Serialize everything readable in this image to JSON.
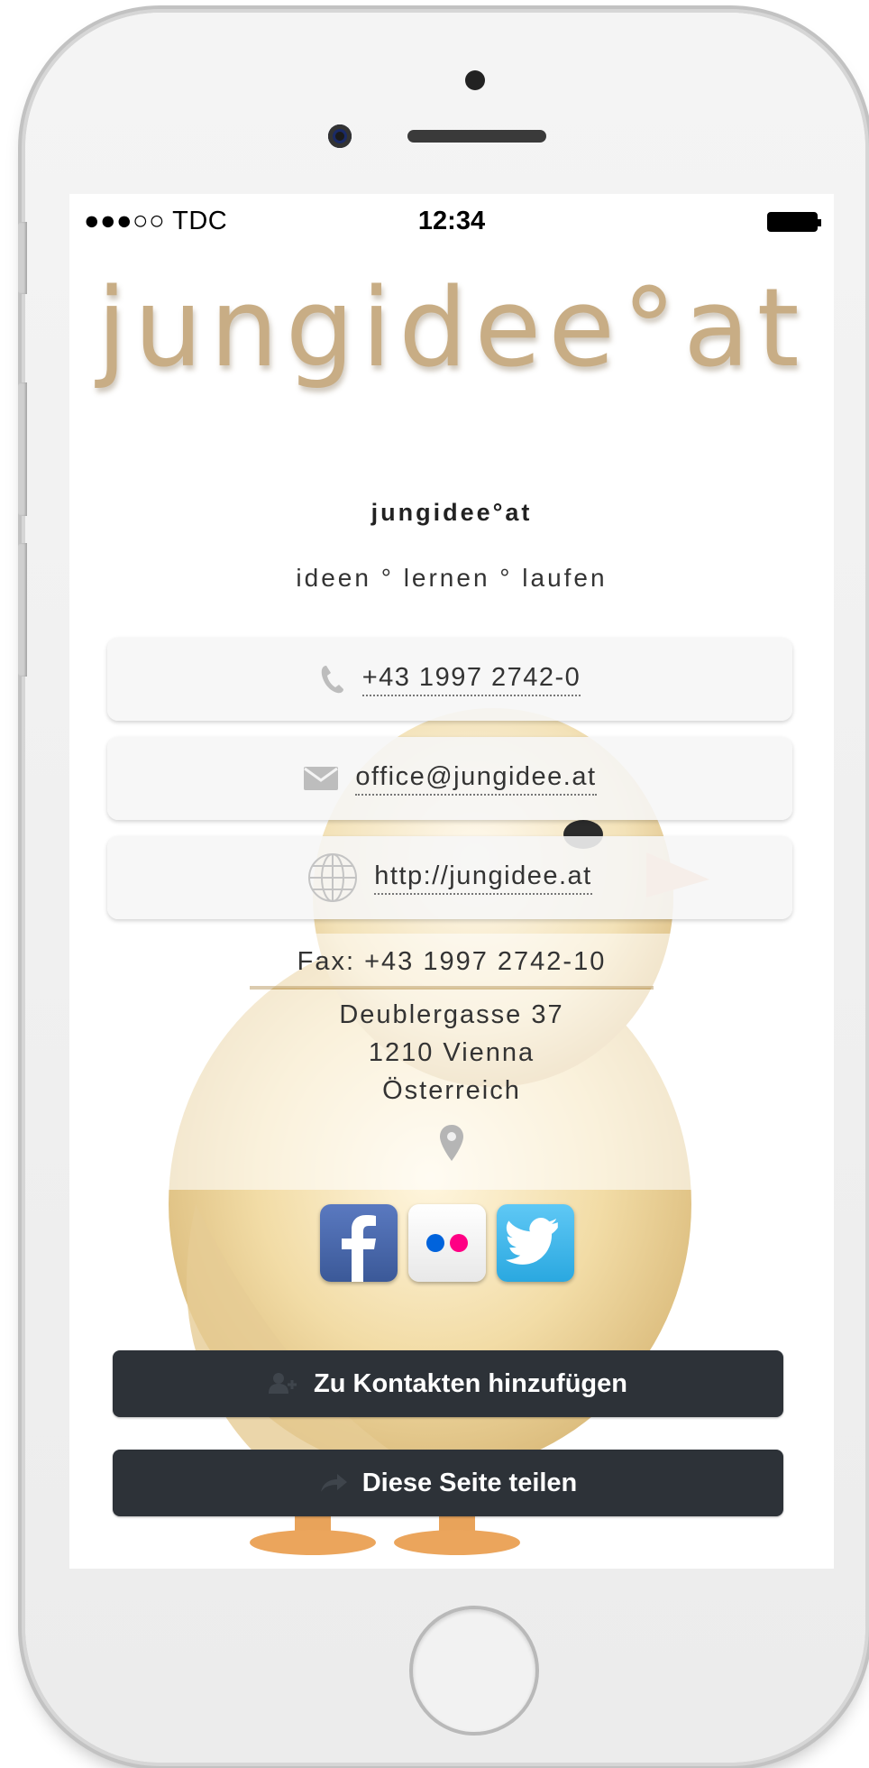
{
  "status_bar": {
    "carrier": "●●●○○ TDC",
    "time": "12:34"
  },
  "logo": "jungidee°at",
  "company_name": "jungidee°at",
  "slogan": "ideen ° lernen ° laufen",
  "contacts": {
    "phone": "+43 1997 2742-0",
    "email": "office@jungidee.at",
    "website": "http://jungidee.at"
  },
  "fax": "Fax: +43 1997 2742-10",
  "address": {
    "street": "Deublergasse 37",
    "city": "1210 Vienna",
    "country": "Österreich"
  },
  "social": [
    "facebook-icon",
    "flickr-icon",
    "twitter-icon"
  ],
  "actions": {
    "add_contact": "Zu Kontakten hinzufügen",
    "share": "Diese Seite teilen"
  },
  "colors": {
    "logo": "#c8ad85",
    "action_button": "#2d3238"
  }
}
